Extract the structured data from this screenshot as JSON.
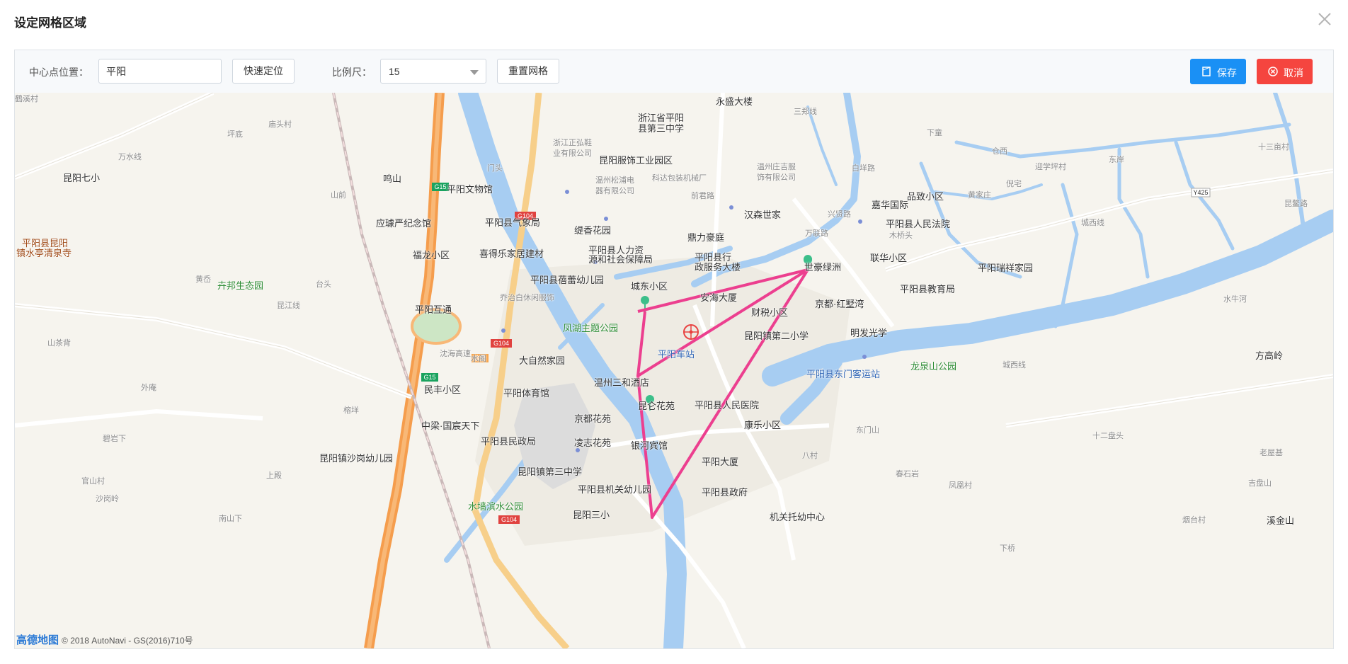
{
  "dialog": {
    "title": "设定网格区域"
  },
  "toolbar": {
    "center_label": "中心点位置：",
    "center_value": "平阳",
    "locate_button": "快速定位",
    "scale_label": "比例尺：",
    "scale_value": "15",
    "reset_button": "重置网格",
    "save_button": "保存",
    "cancel_button": "取消"
  },
  "colors": {
    "save": "#1a90f5",
    "cancel": "#f5453f",
    "grid_polygon": "#ec3f8f",
    "water": "#a7cdf2",
    "expressway": "#f59d4d"
  },
  "map": {
    "attribution_logo": "高德地图",
    "attribution_text": "© 2018 AutoNavi - GS(2016)710号",
    "icons": [
      "school-icon",
      "mountain-icon",
      "museum-icon",
      "tower-icon",
      "park-icon",
      "building-icon",
      "marker-icon",
      "hospital-icon",
      "government-icon",
      "bus-icon",
      "hotel-icon",
      "center-target-icon"
    ],
    "labels": [
      {
        "t": "永盛大楼"
      },
      {
        "t": "浙江省平阳"
      },
      {
        "t": "县第三中学"
      },
      {
        "t": "三郑线"
      },
      {
        "t": "浙江正弘鞋"
      },
      {
        "t": "业有限公司"
      },
      {
        "t": "昆阳服饰工业园区"
      },
      {
        "t": "温州庄吉服"
      },
      {
        "t": "饰有限公司"
      },
      {
        "t": "温州松浦电"
      },
      {
        "t": "器有限公司"
      },
      {
        "t": "科达包装机械厂"
      },
      {
        "t": "前君路"
      },
      {
        "t": "万水线"
      },
      {
        "t": "坪底"
      },
      {
        "t": "庙头村"
      },
      {
        "t": "昆阳七小"
      },
      {
        "t": "鸣山"
      },
      {
        "t": "山前"
      },
      {
        "t": "应璩严纪念馆"
      },
      {
        "t": "平阳县昆阳"
      },
      {
        "t": "镇水亭清泉寺"
      },
      {
        "t": "平阳县气象局"
      },
      {
        "t": "缇香花园"
      },
      {
        "t": "汉森世家"
      },
      {
        "t": "嘉华国际"
      },
      {
        "t": "品致小区"
      },
      {
        "t": "平阳县人民法院"
      },
      {
        "t": "鼎力豪庭"
      },
      {
        "t": "喜得乐家居建材"
      },
      {
        "t": "福龙小区"
      },
      {
        "t": "平阳县人力资"
      },
      {
        "t": "源和社会保障局"
      },
      {
        "t": "平阳县行"
      },
      {
        "t": "政服务大楼"
      },
      {
        "t": "联华小区"
      },
      {
        "t": "世豪绿洲"
      },
      {
        "t": "平阳瑞祥家园"
      },
      {
        "t": "平阳县蓓蕾幼儿园"
      },
      {
        "t": "城东小区"
      },
      {
        "t": "卉邦生态园"
      },
      {
        "t": "黄岙"
      },
      {
        "t": "台头"
      },
      {
        "t": "乔治白休闲服饰"
      },
      {
        "t": "安海大厦"
      },
      {
        "t": "财税小区"
      },
      {
        "t": "京都·红墅湾"
      },
      {
        "t": "平阳县教育局"
      },
      {
        "t": "昆江线"
      },
      {
        "t": "平阳互通"
      },
      {
        "t": "凤湖主题公园"
      },
      {
        "t": "明发光学"
      },
      {
        "t": "昆阳镇第二小学"
      },
      {
        "t": "山茶背"
      },
      {
        "t": "大自然家园"
      },
      {
        "t": "平阳车站"
      },
      {
        "t": "龙泉山公园"
      },
      {
        "t": "平阳县东门客运站"
      },
      {
        "t": "温州三和酒店"
      },
      {
        "t": "民丰小区"
      },
      {
        "t": "平阳体育馆"
      },
      {
        "t": "昆仑花苑"
      },
      {
        "t": "平阳县人民医院"
      },
      {
        "t": "京都花苑"
      },
      {
        "t": "康乐小区"
      },
      {
        "t": "平阳县民政局"
      },
      {
        "t": "凌志花苑"
      },
      {
        "t": "银河宾馆"
      },
      {
        "t": "平阳大厦"
      },
      {
        "t": "昆阳镇沙岗幼儿园"
      },
      {
        "t": "昆阳镇第三中学"
      },
      {
        "t": "平阳县机关幼儿园"
      },
      {
        "t": "平阳县政府"
      },
      {
        "t": "水墙滨水公园"
      },
      {
        "t": "昆阳三小"
      },
      {
        "t": "机关托幼中心"
      },
      {
        "t": "外庵"
      },
      {
        "t": "榕垟"
      },
      {
        "t": "碧岩下"
      },
      {
        "t": "官山村"
      },
      {
        "t": "沙岗岭"
      },
      {
        "t": "上殿"
      },
      {
        "t": "南山下"
      },
      {
        "t": "八村"
      },
      {
        "t": "东门山"
      },
      {
        "t": "城西线"
      },
      {
        "t": "十二盘头"
      },
      {
        "t": "老屋基"
      },
      {
        "t": "吉盘山"
      },
      {
        "t": "凤凰村"
      },
      {
        "t": "春石岩"
      },
      {
        "t": "烟台村"
      },
      {
        "t": "溪金山"
      },
      {
        "t": "方高岭"
      },
      {
        "t": "水牛河"
      },
      {
        "t": "城西线"
      },
      {
        "t": "十三亩村"
      },
      {
        "t": "东岸"
      },
      {
        "t": "仓西"
      },
      {
        "t": "迎学坪村"
      },
      {
        "t": "倪宅"
      },
      {
        "t": "黄家庄"
      },
      {
        "t": "木桥头"
      },
      {
        "t": "万联路"
      },
      {
        "t": "兴贤路"
      },
      {
        "t": "白垟路"
      },
      {
        "t": "下童"
      },
      {
        "t": "昆鳌路"
      },
      {
        "t": "下桥"
      },
      {
        "t": "Y425"
      },
      {
        "t": "中梁·国宸天下"
      },
      {
        "t": "平阳文物馆"
      },
      {
        "t": "沈海高速"
      },
      {
        "t": "G104"
      },
      {
        "t": "G15"
      },
      {
        "t": "水阁"
      },
      {
        "t": "门头"
      },
      {
        "t": "收费"
      },
      {
        "t": "吕一村"
      },
      {
        "t": "鹤溪村"
      }
    ]
  }
}
